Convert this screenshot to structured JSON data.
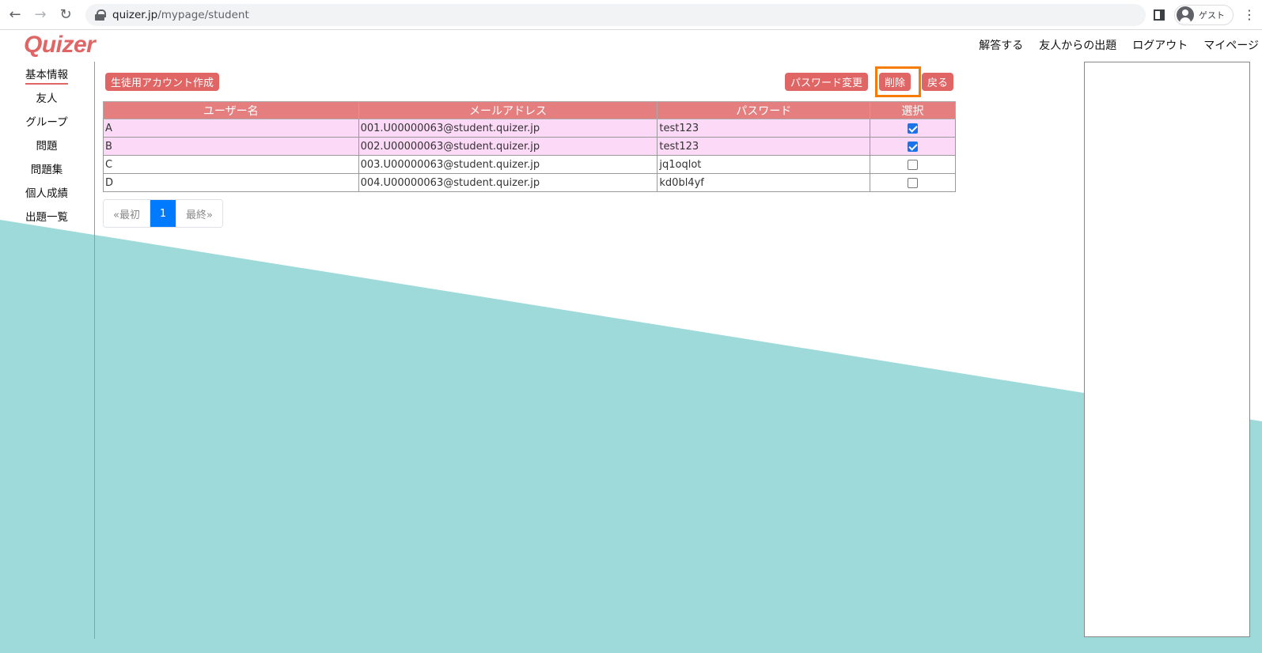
{
  "browser": {
    "url_host": "quizer.jp",
    "url_path": "/mypage/student",
    "profile_label": "ゲスト"
  },
  "header": {
    "logo": "Quizer",
    "nav": [
      "解答する",
      "友人からの出題",
      "ログアウト",
      "マイページ"
    ]
  },
  "sidebar": {
    "items": [
      {
        "label": "基本情報",
        "active": true
      },
      {
        "label": "友人",
        "active": false
      },
      {
        "label": "グループ",
        "active": false
      },
      {
        "label": "問題",
        "active": false
      },
      {
        "label": "問題集",
        "active": false
      },
      {
        "label": "個人成績",
        "active": false
      },
      {
        "label": "出題一覧",
        "active": false
      }
    ]
  },
  "toolbar": {
    "create_label": "生徒用アカウント作成",
    "password_label": "パスワード変更",
    "delete_label": "削除",
    "back_label": "戻る"
  },
  "table": {
    "headers": [
      "ユーザー名",
      "メールアドレス",
      "パスワード",
      "選択"
    ],
    "rows": [
      {
        "username": "A",
        "email": "001.U00000063@student.quizer.jp",
        "password": "test123",
        "selected": true
      },
      {
        "username": "B",
        "email": "002.U00000063@student.quizer.jp",
        "password": "test123",
        "selected": true
      },
      {
        "username": "C",
        "email": "003.U00000063@student.quizer.jp",
        "password": "jq1oqlot",
        "selected": false
      },
      {
        "username": "D",
        "email": "004.U00000063@student.quizer.jp",
        "password": "kd0bl4yf",
        "selected": false
      }
    ]
  },
  "pagination": {
    "first_label": "«最初",
    "current_page": "1",
    "last_label": "最終»"
  },
  "colors": {
    "accent": "#e06666",
    "teal_background": "#9fdadb",
    "selected_row": "#fcd9f7",
    "highlight_box": "#f57c00"
  }
}
